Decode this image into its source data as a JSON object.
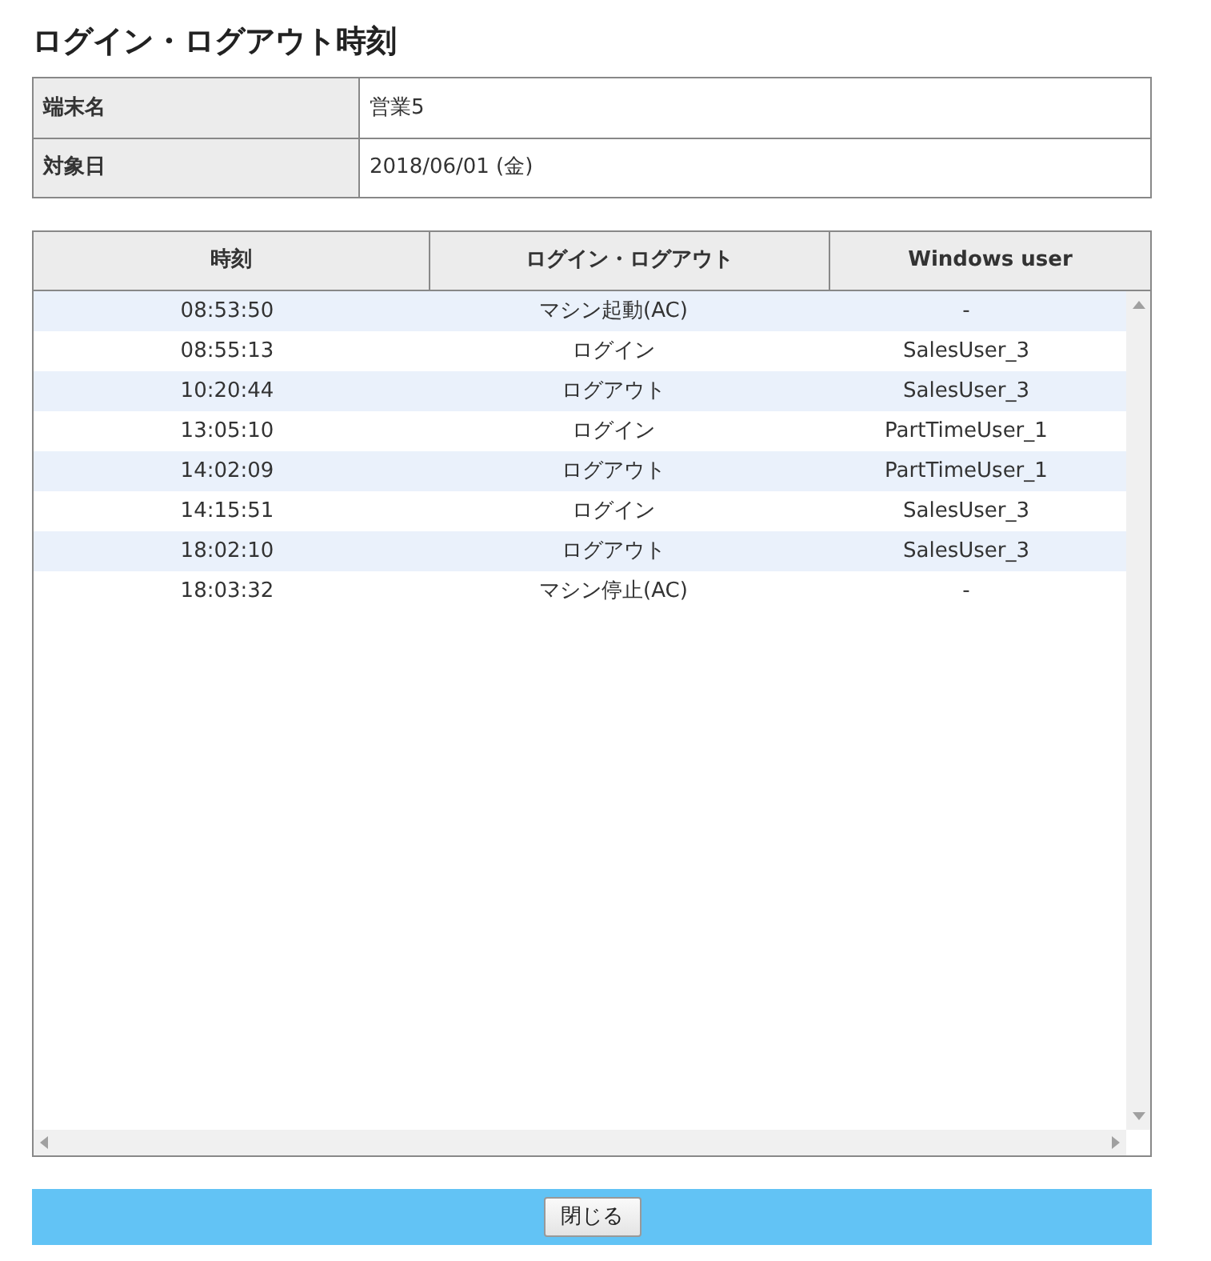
{
  "title": "ログイン・ログアウト時刻",
  "info": [
    {
      "label": "端末名",
      "value": "営業5"
    },
    {
      "label": "対象日",
      "value": "2018/06/01 (金)"
    }
  ],
  "table": {
    "columns": [
      "時刻",
      "ログイン・ログアウト",
      "Windows user"
    ],
    "rows": [
      [
        "08:53:50",
        "マシン起動(AC)",
        "-"
      ],
      [
        "08:55:13",
        "ログイン",
        "SalesUser_3"
      ],
      [
        "10:20:44",
        "ログアウト",
        "SalesUser_3"
      ],
      [
        "13:05:10",
        "ログイン",
        "PartTimeUser_1"
      ],
      [
        "14:02:09",
        "ログアウト",
        "PartTimeUser_1"
      ],
      [
        "14:15:51",
        "ログイン",
        "SalesUser_3"
      ],
      [
        "18:02:10",
        "ログアウト",
        "SalesUser_3"
      ],
      [
        "18:03:32",
        "マシン停止(AC)",
        "-"
      ]
    ]
  },
  "close_button": "閉じる"
}
